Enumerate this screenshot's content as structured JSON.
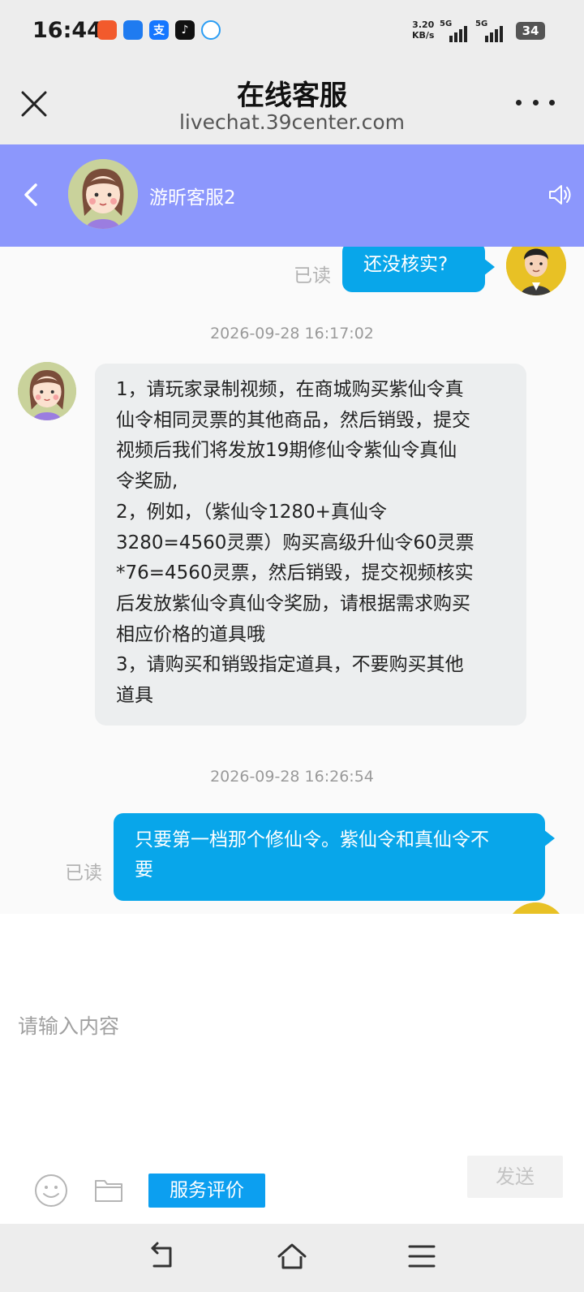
{
  "status_bar": {
    "time": "16:44",
    "net_speed_value": "3.20",
    "net_speed_unit": "KB/s",
    "signal1_label": "5G",
    "signal2_label": "5G",
    "battery": "34"
  },
  "title_bar": {
    "title": "在线客服",
    "url": "livechat.39center.com"
  },
  "chat_header": {
    "agent_name": "游昕客服2",
    "background_color": "#8c97fc"
  },
  "messages": [
    {
      "type": "outgoing",
      "text": "还没核实?",
      "read_status": "已读"
    },
    {
      "type": "timestamp",
      "text": "2026-09-28 16:17:02"
    },
    {
      "type": "incoming",
      "lines": [
        "1，请玩家录制视频，在商城购买紫仙令真",
        "仙令相同灵票的其他商品，然后销毁，提交",
        "视频后我们将发放19期修仙令紫仙令真仙",
        "令奖励,",
        "2，例如，（紫仙令1280+真仙令",
        "3280=4560灵票）购买高级升仙令60灵票",
        "*76=4560灵票，然后销毁，提交视频核实",
        "后发放紫仙令真仙令奖励，请根据需求购买",
        "相应价格的道具哦",
        "3，请购买和销毁指定道具，不要购买其他",
        "道具"
      ]
    },
    {
      "type": "timestamp",
      "text": "2026-09-28 16:26:54"
    },
    {
      "type": "outgoing",
      "lines": [
        "只要第一档那个修仙令。紫仙令和真仙令不",
        "要"
      ],
      "read_status": "已读"
    }
  ],
  "input": {
    "placeholder": "请输入内容",
    "rate_button": "服务评价",
    "send_button": "发送"
  },
  "colors": {
    "outgoing_bubble": "#08a6ea",
    "incoming_bubble": "#eceeef",
    "rate_button": "#0c9ff0"
  }
}
